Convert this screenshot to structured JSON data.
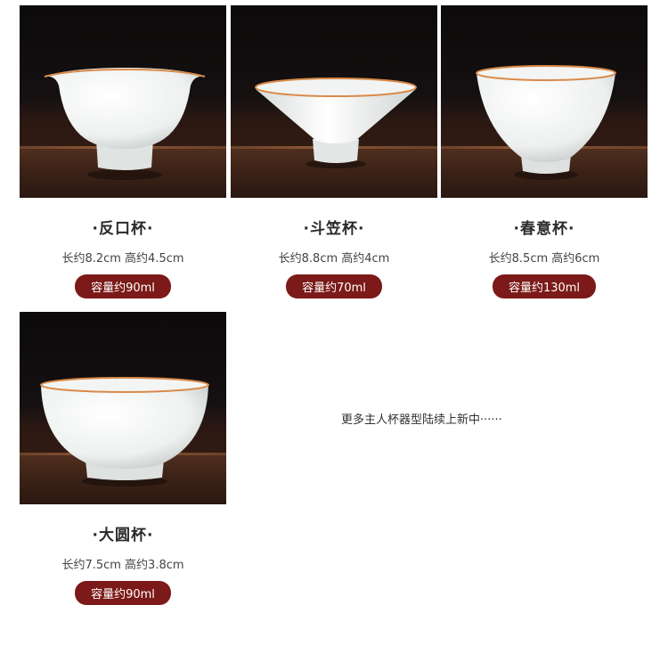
{
  "products": [
    {
      "title": "·反口杯·",
      "dims": "长约8.2cm  高约4.5cm",
      "capacity": "容量约90ml",
      "image": "cup-fankou-photo"
    },
    {
      "title": "·斗笠杯·",
      "dims": "长约8.8cm  高约4cm",
      "capacity": "容量约70ml",
      "image": "cup-douli-photo"
    },
    {
      "title": "·春意杯·",
      "dims": "长约8.5cm  高约6cm",
      "capacity": "容量约130ml",
      "image": "cup-chunyi-photo"
    },
    {
      "title": "·大圆杯·",
      "dims": "长约7.5cm  高约3.8cm",
      "capacity": "容量约90ml",
      "image": "cup-dayuan-photo"
    }
  ],
  "note": "更多主人杯器型陆续上新中······",
  "colors": {
    "capacity_badge": "#7b1a18",
    "background": "#ffffff"
  }
}
